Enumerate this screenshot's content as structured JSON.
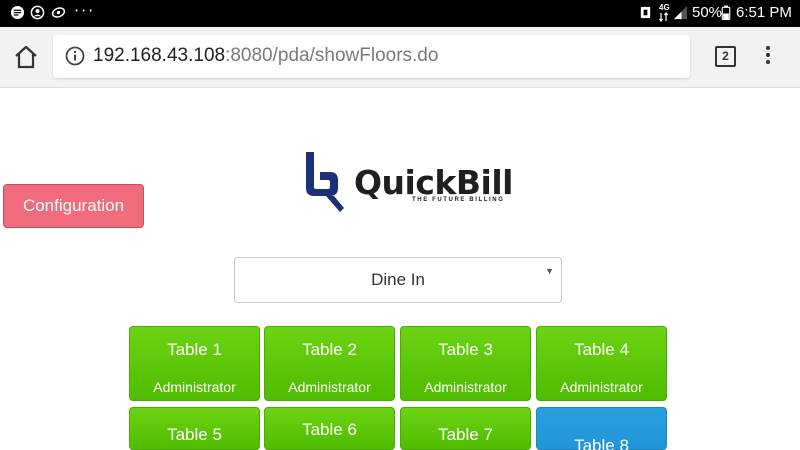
{
  "status_bar": {
    "network": "4G",
    "battery": "50%",
    "time": "6:51 PM",
    "more": "···"
  },
  "browser": {
    "url_host": "192.168.43.108",
    "url_rest": ":8080/pda/showFloors.do",
    "tab_count": "2"
  },
  "page": {
    "configuration_label": "Configuration",
    "logo": {
      "name": "QuickBill",
      "tagline": "THE FUTURE BILLING"
    },
    "order_type": {
      "selected": "Dine In"
    },
    "tables": [
      {
        "name": "Table 1",
        "user": "Administrator",
        "status_color": "#5cc70a"
      },
      {
        "name": "Table 2",
        "user": "Administrator",
        "status_color": "#5cc70a"
      },
      {
        "name": "Table 3",
        "user": "Administrator",
        "status_color": "#5cc70a"
      },
      {
        "name": "Table 4",
        "user": "Administrator",
        "status_color": "#5cc70a"
      },
      {
        "name": "Table 5",
        "status_color": "#5cc70a"
      },
      {
        "name": "Table 6",
        "status_color": "#5cc70a"
      },
      {
        "name": "Table 7",
        "status_color": "#5cc70a"
      },
      {
        "name": "Table 8",
        "status_color": "#2598dc"
      }
    ]
  },
  "colors": {
    "config_button": "#f06b7b",
    "tile_green": "#5cc70a",
    "tile_blue": "#2598dc",
    "logo_blue": "#1b2f7a"
  }
}
